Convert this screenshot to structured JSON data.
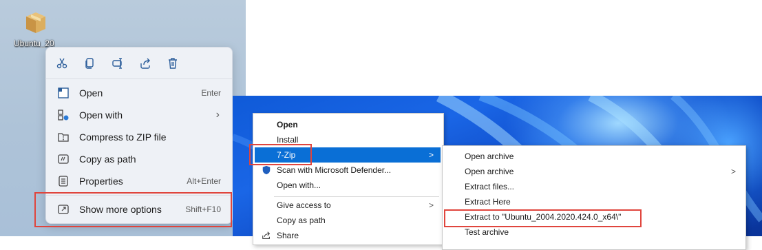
{
  "desktop": {
    "icon_label": "Ubuntu_20..."
  },
  "win11_menu": {
    "toolbar": [
      {
        "name": "cut-icon"
      },
      {
        "name": "copy-icon"
      },
      {
        "name": "rename-icon"
      },
      {
        "name": "share-icon"
      },
      {
        "name": "delete-icon"
      }
    ],
    "items": [
      {
        "label": "Open",
        "shortcut": "Enter",
        "icon": "open-icon"
      },
      {
        "label": "Open with",
        "shortcut": "",
        "arrow": "›",
        "icon": "open-with-icon"
      },
      {
        "label": "Compress to ZIP file",
        "shortcut": "",
        "icon": "zip-folder-icon"
      },
      {
        "label": "Copy as path",
        "shortcut": "",
        "icon": "copy-path-icon"
      },
      {
        "label": "Properties",
        "shortcut": "Alt+Enter",
        "icon": "properties-icon"
      }
    ],
    "more": {
      "label": "Show more options",
      "shortcut": "Shift+F10",
      "icon": "show-more-icon"
    }
  },
  "classic_menu": {
    "items": [
      {
        "label": "Open",
        "bold": true
      },
      {
        "label": "Install"
      },
      {
        "label": "7-Zip",
        "arrow": ">",
        "highlighted": true
      },
      {
        "label": "Scan with Microsoft Defender...",
        "icon": "defender-shield-icon"
      },
      {
        "label": "Open with..."
      },
      {
        "label": "Give access to",
        "arrow": ">"
      },
      {
        "label": "Copy as path"
      },
      {
        "label": "Share",
        "icon": "share-icon"
      }
    ]
  },
  "sevenzip_submenu": {
    "items": [
      {
        "label": "Open archive"
      },
      {
        "label": "Open archive",
        "arrow": ">"
      },
      {
        "label": "Extract files..."
      },
      {
        "label": "Extract Here"
      },
      {
        "label": "Extract to \"Ubuntu_2004.2020.424.0_x64\\\""
      },
      {
        "label": "Test archive"
      }
    ]
  },
  "colors": {
    "highlight": "#0a6fd6",
    "annotation_red": "#e0453d",
    "menu_bg_win11": "#eef1f6"
  }
}
